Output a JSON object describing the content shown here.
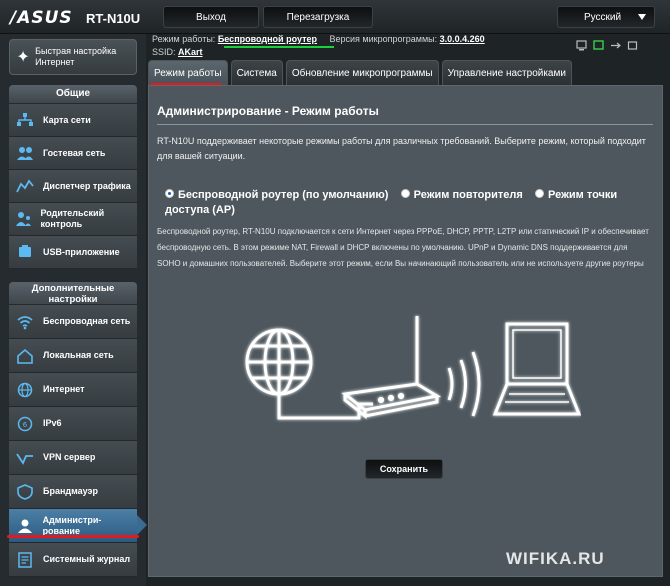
{
  "header": {
    "logo": "/ASUS",
    "model": "RT-N10U",
    "logout": "Выход",
    "reboot": "Перезагрузка",
    "language": "Русский"
  },
  "info": {
    "mode_label": "Режим работы:",
    "mode_value": "Беспроводной роутер",
    "firmware_label": "Версия микропрограммы:",
    "firmware_value": "3.0.0.4.260",
    "ssid_label": "SSID:",
    "ssid_value": "AKart"
  },
  "sidebar": {
    "quick_setup": "Быстрая настройка Интернет",
    "general_header": "Общие",
    "general_items": [
      {
        "label": "Карта сети",
        "icon": "network-map-icon"
      },
      {
        "label": "Гостевая сеть",
        "icon": "guest-network-icon"
      },
      {
        "label": "Диспетчер трафика",
        "icon": "traffic-manager-icon"
      },
      {
        "label": "Родительский контроль",
        "icon": "parental-control-icon"
      },
      {
        "label": "USB-приложение",
        "icon": "usb-app-icon"
      }
    ],
    "advanced_header": "Дополнительные настройки",
    "advanced_items": [
      {
        "label": "Беспроводная сеть",
        "icon": "wireless-icon"
      },
      {
        "label": "Локальная сеть",
        "icon": "lan-icon"
      },
      {
        "label": "Интернет",
        "icon": "internet-icon"
      },
      {
        "label": "IPv6",
        "icon": "ipv6-icon"
      },
      {
        "label": "VPN сервер",
        "icon": "vpn-icon"
      },
      {
        "label": "Брандмауэр",
        "icon": "firewall-icon"
      },
      {
        "label": "Администри-рование",
        "icon": "admin-icon"
      },
      {
        "label": "Системный журнал",
        "icon": "syslog-icon"
      }
    ]
  },
  "tabs": [
    "Режим работы",
    "Система",
    "Обновление микропрограммы",
    "Управление настройками"
  ],
  "main": {
    "title": "Администрирование - Режим работы",
    "description": "RT-N10U поддерживает некоторые режимы работы для различных требований. Выберите режим, который подходит для вашей ситуации.",
    "mode_router": "Беспроводной роутер (по умолчанию)",
    "mode_repeater": "Режим повторителя",
    "mode_ap": "Режим точки доступа (AP)",
    "mode_description": "Беспроводной роутер, RT-N10U подключается к сети Интернет через PPPoE, DHCP, PPTP, L2TP или статический IP и обеспечивает беспроводную сеть. В этом режиме NAT, Firewall и DHCP включены по умолчанию. UPnP и Dynamic DNS поддерживается для SOHO и домашних пользователей. Выберите этот режим, если Вы начинающий пользователь или не используете другие роутеры",
    "save": "Сохранить"
  },
  "watermark": "WIFIKA.RU"
}
